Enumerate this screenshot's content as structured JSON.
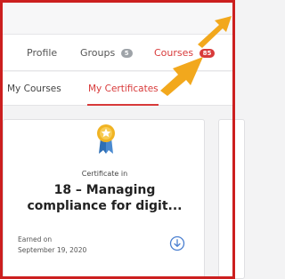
{
  "tabs": [
    {
      "label": "Profile"
    },
    {
      "label": "Groups",
      "badge": "5"
    },
    {
      "label": "Courses",
      "badge": "85"
    }
  ],
  "subtabs": [
    {
      "label": "My Courses"
    },
    {
      "label": "My Certificates"
    }
  ],
  "certificate": {
    "prefix": "Certificate in",
    "title": "18 – Managing compliance for digit...",
    "earned_label": "Earned on",
    "earned_date": "September 19, 2020"
  },
  "colors": {
    "accent": "#d83a3a",
    "annotation_arrow": "#f2a81d",
    "frame": "#cc1f1f"
  },
  "icons": {
    "certificate": "medal-icon",
    "download": "download-circle-icon"
  }
}
